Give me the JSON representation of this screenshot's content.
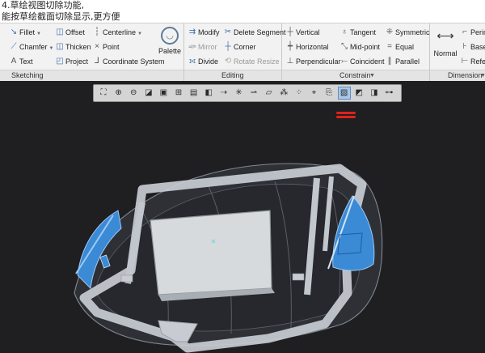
{
  "caption": {
    "line1": "4.草绘视图切除功能,",
    "line2": "能按草绘截面切除显示,更方便"
  },
  "ribbon": {
    "sketching": {
      "label": "Sketching",
      "fillet": "Fillet",
      "chamfer": "Chamfer",
      "text": "Text",
      "offset": "Offset",
      "thicken": "Thicken",
      "project": "Project",
      "centerline": "Centerline",
      "point": "Point",
      "coordinate_system": "Coordinate System",
      "palette": "Palette"
    },
    "editing": {
      "label": "Editing",
      "modify": "Modify",
      "delete_segment": "Delete Segment",
      "mirror": "Mirror",
      "corner": "Corner",
      "divide": "Divide",
      "rotate_resize": "Rotate Resize"
    },
    "constrain": {
      "label": "Constrain",
      "vertical": "Vertical",
      "tangent": "Tangent",
      "symmetric": "Symmetric",
      "horizontal": "Horizontal",
      "mid_point": "Mid-point",
      "equal": "Equal",
      "perpendicular": "Perpendicular",
      "coincident": "Coincident",
      "parallel": "Parallel"
    },
    "dimension": {
      "label": "Dimension",
      "normal": "Normal",
      "perimeter": "Perim",
      "baseline": "Basel",
      "reference": "Refer"
    }
  },
  "view_toolbar": {
    "buttons": [
      {
        "name": "refit-icon",
        "glyph": "⛶"
      },
      {
        "name": "zoom-in-icon",
        "glyph": "⊕"
      },
      {
        "name": "zoom-out-icon",
        "glyph": "⊖"
      },
      {
        "name": "repaint-icon",
        "glyph": "◪"
      },
      {
        "name": "display-style-icon",
        "glyph": "▣"
      },
      {
        "name": "saved-orientations-icon",
        "glyph": "⊞"
      },
      {
        "name": "view-manager-icon",
        "glyph": "▤"
      },
      {
        "name": "perspective-view-icon",
        "glyph": "◧"
      },
      {
        "name": "datum-display-icon",
        "glyph": "⇢"
      },
      {
        "name": "spin-center-icon",
        "glyph": "✳"
      },
      {
        "name": "annotation-display-icon",
        "glyph": "⇀"
      },
      {
        "name": "plane-display-icon",
        "glyph": "▱"
      },
      {
        "name": "axis-display-icon",
        "glyph": "⁂"
      },
      {
        "name": "point-display-icon",
        "glyph": "⁘"
      },
      {
        "name": "csys-display-icon",
        "glyph": "⌖"
      },
      {
        "name": "sketch-view-icon",
        "glyph": "⎘"
      },
      {
        "name": "sketch-view-section-icon",
        "glyph": "▧"
      },
      {
        "name": "sketcher-display-filters-icon",
        "glyph": "◩"
      },
      {
        "name": "constraint-display-icon",
        "glyph": "◨"
      },
      {
        "name": "disp-vertex-icon",
        "glyph": "⊶"
      }
    ],
    "active_index": 16
  },
  "colors": {
    "viewport_bg": "#1f1f22",
    "annotation_red": "#e0201b",
    "accent_blue": "#3a8ad6",
    "ribbon_bg": "#f2f2f2"
  }
}
